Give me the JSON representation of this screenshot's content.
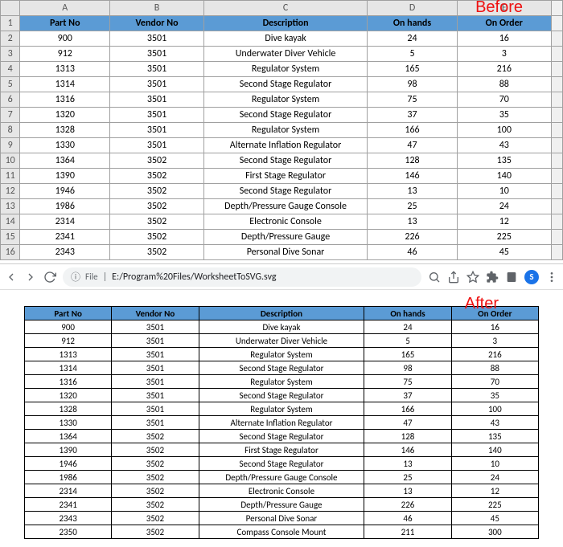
{
  "labels": {
    "before": "Before",
    "after": "After"
  },
  "spreadsheet": {
    "colLetters": [
      "A",
      "B",
      "C",
      "D",
      "E"
    ],
    "rowNumbers": [
      1,
      2,
      3,
      4,
      5,
      6,
      7,
      8,
      9,
      10,
      11,
      12,
      13,
      14,
      15,
      16
    ],
    "headers": [
      "Part No",
      "Vendor No",
      "Description",
      "On hands",
      "On Order"
    ],
    "rows": [
      [
        "900",
        "3501",
        "Dive kayak",
        "24",
        "16"
      ],
      [
        "912",
        "3501",
        "Underwater Diver Vehicle",
        "5",
        "3"
      ],
      [
        "1313",
        "3501",
        "Regulator System",
        "165",
        "216"
      ],
      [
        "1314",
        "3501",
        "Second Stage Regulator",
        "98",
        "88"
      ],
      [
        "1316",
        "3501",
        "Regulator System",
        "75",
        "70"
      ],
      [
        "1320",
        "3501",
        "Second Stage Regulator",
        "37",
        "35"
      ],
      [
        "1328",
        "3501",
        "Regulator System",
        "166",
        "100"
      ],
      [
        "1330",
        "3501",
        "Alternate Inflation Regulator",
        "47",
        "43"
      ],
      [
        "1364",
        "3502",
        "Second Stage Regulator",
        "128",
        "135"
      ],
      [
        "1390",
        "3502",
        "First Stage Regulator",
        "146",
        "140"
      ],
      [
        "1946",
        "3502",
        "Second Stage Regulator",
        "13",
        "10"
      ],
      [
        "1986",
        "3502",
        "Depth/Pressure Gauge Console",
        "25",
        "24"
      ],
      [
        "2314",
        "3502",
        "Electronic Console",
        "13",
        "12"
      ],
      [
        "2341",
        "3502",
        "Depth/Pressure Gauge",
        "226",
        "225"
      ],
      [
        "2343",
        "3502",
        "Personal Dive Sonar",
        "46",
        "45"
      ]
    ]
  },
  "browser": {
    "fileLabel": "File",
    "url": "E:/Program%20Files/WorksheetToSVG.svg",
    "avatar": "S"
  },
  "svgOutput": {
    "headers": [
      "Part No",
      "Vendor No",
      "Description",
      "On hands",
      "On Order"
    ],
    "rows": [
      [
        "900",
        "3501",
        "Dive kayak",
        "24",
        "16"
      ],
      [
        "912",
        "3501",
        "Underwater Diver Vehicle",
        "5",
        "3"
      ],
      [
        "1313",
        "3501",
        "Regulator System",
        "165",
        "216"
      ],
      [
        "1314",
        "3501",
        "Second Stage Regulator",
        "98",
        "88"
      ],
      [
        "1316",
        "3501",
        "Regulator System",
        "75",
        "70"
      ],
      [
        "1320",
        "3501",
        "Second Stage Regulator",
        "37",
        "35"
      ],
      [
        "1328",
        "3501",
        "Regulator System",
        "166",
        "100"
      ],
      [
        "1330",
        "3501",
        "Alternate Inflation Regulator",
        "47",
        "43"
      ],
      [
        "1364",
        "3502",
        "Second Stage Regulator",
        "128",
        "135"
      ],
      [
        "1390",
        "3502",
        "First Stage Regulator",
        "146",
        "140"
      ],
      [
        "1946",
        "3502",
        "Second Stage Regulator",
        "13",
        "10"
      ],
      [
        "1986",
        "3502",
        "Depth/Pressure Gauge Console",
        "25",
        "24"
      ],
      [
        "2314",
        "3502",
        "Electronic Console",
        "13",
        "12"
      ],
      [
        "2341",
        "3502",
        "Depth/Pressure Gauge",
        "226",
        "225"
      ],
      [
        "2343",
        "3502",
        "Personal Dive Sonar",
        "46",
        "45"
      ],
      [
        "2350",
        "3502",
        "Compass Console Mount",
        "211",
        "300"
      ]
    ]
  }
}
